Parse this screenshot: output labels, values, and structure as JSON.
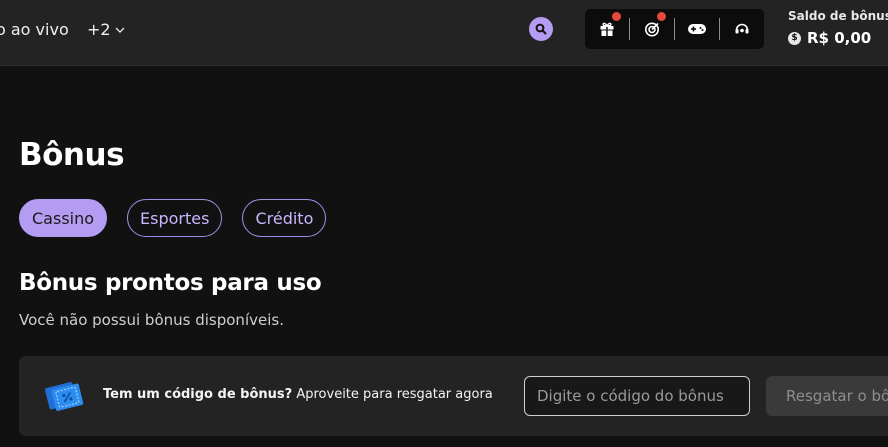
{
  "nav": {
    "live_label": "o ao vivo",
    "more_label": "+2"
  },
  "header": {
    "icons": [
      "search-icon",
      "gift-icon",
      "target-icon",
      "gamepad-icon",
      "headset-icon"
    ],
    "balance_label": "Saldo de bônus",
    "balance_currency_icon": "$",
    "balance_value": "R$ 0,00",
    "accent_color": "#b49cf3",
    "notification_color": "#e54a3a"
  },
  "page": {
    "title": "Bônus",
    "tabs": [
      {
        "label": "Cassino",
        "active": true
      },
      {
        "label": "Esportes",
        "active": false
      },
      {
        "label": "Crédito",
        "active": false
      }
    ],
    "section_title": "Bônus prontos para uso",
    "section_empty": "Você não possui bônus disponíveis."
  },
  "promo": {
    "ticket_icon": "ticket-icon",
    "headline": "Tem um código de bônus?",
    "text": "Aproveite para resgatar agora",
    "input_placeholder": "Digite o código do bônus",
    "button_label": "Resgatar o bônus"
  }
}
